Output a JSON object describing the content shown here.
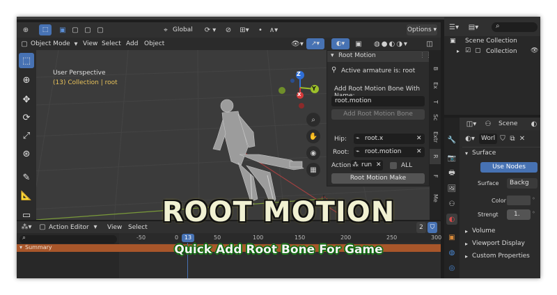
{
  "viewport_header": {
    "transform_orientation": "Global",
    "options_label": "Options",
    "mode": "Object Mode",
    "menus": [
      "View",
      "Select",
      "Add",
      "Object"
    ]
  },
  "viewport": {
    "perspective_label": "User Perspective",
    "collection_label": "(13) Collection | root",
    "gizmo_axes": [
      "Z",
      "Y",
      "X"
    ]
  },
  "root_motion_panel": {
    "title": "Root Motion",
    "active_armature": "Active armature is: root",
    "add_bone_label": "Add Root Motion Bone With Name:",
    "bone_name_value": "root.motion",
    "add_bone_button": "Add Root Motion Bone",
    "hip_label": "Hip:",
    "hip_value": "root.x",
    "root_label": "Root:",
    "root_value": "root.motion",
    "action_label": "Action",
    "action_value": "run",
    "all_label": "ALL",
    "make_button": "Root Motion Make"
  },
  "npanel_tabs": [
    "B",
    "Ex",
    "T",
    "Sc",
    "Extr",
    "R",
    "F",
    "Me"
  ],
  "outliner": {
    "scene_collection": "Scene Collection",
    "collection": "Collection"
  },
  "properties": {
    "scene_label": "Scene",
    "world_name": "Worl",
    "surface_section": "Surface",
    "use_nodes_button": "Use Nodes",
    "surface_label": "Surface",
    "surface_value": "Backg",
    "color_label": "Color",
    "strength_label": "Strengt",
    "strength_value": "1.",
    "volume_section": "Volume",
    "viewport_display_section": "Viewport Display",
    "custom_properties_section": "Custom Properties"
  },
  "timeline": {
    "editor": "Action Editor",
    "menus": [
      "View",
      "Select"
    ],
    "current_frame": "13",
    "ticks": [
      "-50",
      "0",
      "50",
      "100",
      "150",
      "200",
      "250",
      "300"
    ],
    "summary_label": "Summary",
    "user_count": "2"
  },
  "overlay": {
    "title": "ROOT MOTION",
    "subtitle": "Quick Add Root Bone For Game"
  }
}
